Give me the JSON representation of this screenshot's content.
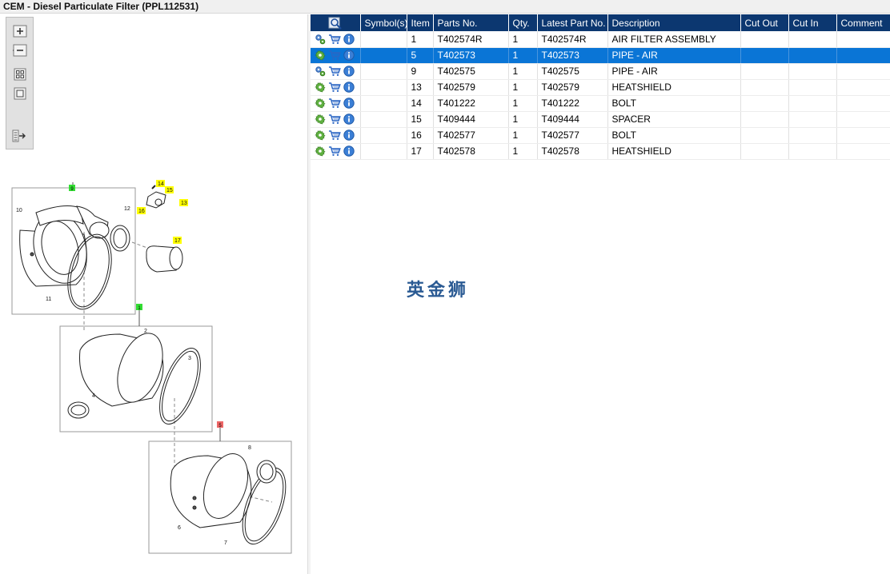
{
  "window": {
    "title": "CEM - Diesel Particulate Filter (PPL112531)"
  },
  "toolbar": {
    "buttons": [
      {
        "name": "zoom-in",
        "icon": "zoom-in-icon"
      },
      {
        "name": "zoom-out",
        "icon": "zoom-out-icon"
      },
      {
        "name": "fit-all",
        "icon": "fit-all-icon"
      },
      {
        "name": "fit-window",
        "icon": "fit-window-icon"
      },
      {
        "name": "show-list",
        "icon": "list-arrow-icon"
      }
    ]
  },
  "table": {
    "columns": [
      "Symbol(s)",
      "Item",
      "Parts No.",
      "Qty.",
      "Latest Part No.",
      "Description",
      "Cut Out",
      "Cut In",
      "Comment"
    ],
    "rows": [
      {
        "item": "1",
        "part_no": "T402574R",
        "qty": "1",
        "latest": "T402574R",
        "desc": "AIR FILTER ASSEMBLY",
        "gear": "gears-icon"
      },
      {
        "item": "5",
        "part_no": "T402573",
        "qty": "1",
        "latest": "T402573",
        "desc": "PIPE - AIR",
        "gear": "gear-green-icon"
      },
      {
        "item": "9",
        "part_no": "T402575",
        "qty": "1",
        "latest": "T402575",
        "desc": "PIPE - AIR",
        "gear": "gears-icon"
      },
      {
        "item": "13",
        "part_no": "T402579",
        "qty": "1",
        "latest": "T402579",
        "desc": "HEATSHIELD",
        "gear": "gear-green-icon"
      },
      {
        "item": "14",
        "part_no": "T401222",
        "qty": "1",
        "latest": "T401222",
        "desc": "BOLT",
        "gear": "gear-green-icon"
      },
      {
        "item": "15",
        "part_no": "T409444",
        "qty": "1",
        "latest": "T409444",
        "desc": "SPACER",
        "gear": "gear-green-icon"
      },
      {
        "item": "16",
        "part_no": "T402577",
        "qty": "1",
        "latest": "T402577",
        "desc": "BOLT",
        "gear": "gear-green-icon"
      },
      {
        "item": "17",
        "part_no": "T402578",
        "qty": "1",
        "latest": "T402578",
        "desc": "HEATSHIELD",
        "gear": "gear-green-icon"
      }
    ],
    "selected_index": 1
  },
  "diagram": {
    "callouts": [
      "1",
      "2",
      "3",
      "4",
      "5",
      "6",
      "7",
      "8",
      "9",
      "10",
      "11",
      "12",
      "13",
      "14",
      "15",
      "16",
      "17"
    ],
    "group_tags": {
      "top": "9",
      "middle": "1",
      "bottom": "5"
    }
  },
  "watermark": {
    "text": "英金狮"
  },
  "colors": {
    "header": "#0c3770",
    "selected": "#0a75d6",
    "highlight": "#ffff00",
    "tag_green": "#33dd33",
    "tag_red": "#ee6666"
  }
}
